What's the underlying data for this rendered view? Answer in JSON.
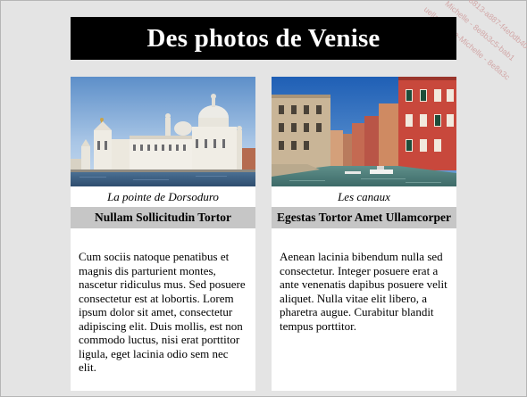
{
  "page": {
    "title": "Des photos de Venise"
  },
  "cards": [
    {
      "image_icon": "venice-dorsoduro-photo",
      "caption": "La pointe de Dorsoduro",
      "heading": "Nullam Sollicitudin Tortor",
      "text": "Cum sociis natoque penatibus et magnis dis parturient montes, nascetur ridiculus mus. Sed posuere consectetur est at lobortis. Lorem ipsum dolor sit amet, consectetur adipiscing elit. Duis mollis, est non commodo luctus, nisi erat porttitor ligula, eget lacinia odio sem nec elit."
    },
    {
      "image_icon": "venice-canals-photo",
      "caption": "Les canaux",
      "heading": "Egestas Tortor Amet Ullamcorper",
      "text": "Aenean lacinia bibendum nulla sed consectetur. Integer posuere erat a ante venenatis dapibus posuere velit aliquet. Nulla vitae elit libero, a pharetra augue. Curabitur blandit tempus porttitor."
    }
  ],
  "watermark": {
    "lines": [
      "8813-a887-f4e0db40",
      "Michelle - 8e8b3c5-bab1",
      "uellas Marie-Michelle - 8e8a3c"
    ]
  },
  "colors": {
    "page_bg": "#e4e4e4",
    "header_bg": "#000000",
    "header_text": "#ffffff",
    "title_bar_bg": "#c6c6c6"
  }
}
